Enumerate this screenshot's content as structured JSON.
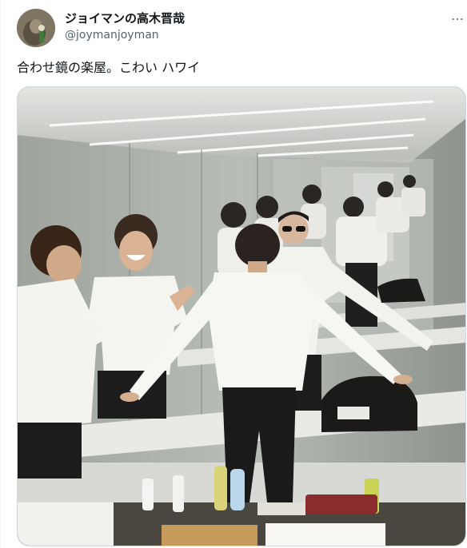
{
  "author": {
    "display_name": "ジョイマンの高木晋哉",
    "handle": "@joymanjoyman",
    "avatar_icon": "profile-photo"
  },
  "more_icon": "ellipsis-icon",
  "more_label": "…",
  "tweet": {
    "text": "合わせ鏡の楽屋。こわい ハワイ"
  },
  "media": {
    "kind": "photo",
    "colors": {
      "wall": "#a8aca7",
      "ceiling": "#d7d9d6",
      "shirt": "#f2f2ef",
      "pants": "#1c1c1c",
      "counter": "#e9e9e6",
      "border": "#cfd9de"
    }
  }
}
